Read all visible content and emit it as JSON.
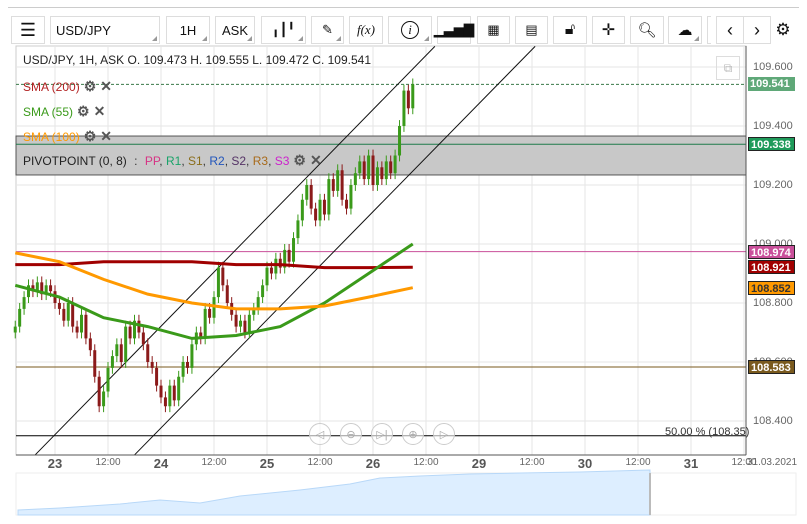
{
  "toolbar": {
    "menu_icon": "hamburger-icon",
    "symbol": "USD/JPY",
    "timeframe": "1H",
    "price_type": "ASK",
    "buttons": [
      "candlestick-icon",
      "pencil-icon",
      "function-icon",
      "info-icon",
      "bar-chart-icon",
      "calendar-icon",
      "report-icon",
      "lock-icon",
      "crosshair-icon",
      "zoom-icon",
      "cloud-upload-icon",
      "chevron-left-icon",
      "chevron-right-icon",
      "gear-icon"
    ],
    "fx_label": "f(x)"
  },
  "legend": {
    "header": "USD/JPY, 1H, ASK   O. 109.473 H. 109.555 L. 109.472 C. 109.541",
    "indicators": [
      {
        "label": "SMA (200)",
        "color": "#b22222"
      },
      {
        "label": "SMA (55)",
        "color": "#3a9a1a"
      },
      {
        "label": "SMA (100)",
        "color": "#ff9900"
      }
    ],
    "pivot": {
      "label": "PIVOTPOINT (0, 8)",
      "sep": " : ",
      "levels": [
        {
          "t": "PP",
          "c": "#d63384"
        },
        {
          "t": "R1",
          "c": "#1aa36a"
        },
        {
          "t": "S1",
          "c": "#8a6d1a"
        },
        {
          "t": "R2",
          "c": "#2255bb"
        },
        {
          "t": "S2",
          "c": "#553366"
        },
        {
          "t": "R3",
          "c": "#a86a1a"
        },
        {
          "t": "S3",
          "c": "#cc22cc"
        }
      ]
    }
  },
  "price_axis": {
    "ticks": [
      "109.600",
      "109.400",
      "109.200",
      "109.000",
      "108.800",
      "108.600",
      "108.400"
    ],
    "tags": [
      {
        "value": "109.541",
        "bg": "#5fa878"
      },
      {
        "value": "109.338",
        "bg": "#1e9a5a"
      },
      {
        "value": "108.974",
        "bg": "#c94f9a"
      },
      {
        "value": "108.921",
        "bg": "#a00000"
      },
      {
        "value": "108.852",
        "bg": "#ff9900"
      },
      {
        "value": "108.583",
        "bg": "#7a5a1e"
      }
    ]
  },
  "time_axis": {
    "labels": [
      {
        "t": "23",
        "day": true
      },
      {
        "t": "12:00"
      },
      {
        "t": "24",
        "day": true
      },
      {
        "t": "12:00"
      },
      {
        "t": "25",
        "day": true
      },
      {
        "t": "12:00"
      },
      {
        "t": "26",
        "day": true
      },
      {
        "t": "12:00"
      },
      {
        "t": "29",
        "day": true
      },
      {
        "t": "12:00"
      },
      {
        "t": "30",
        "day": true
      },
      {
        "t": "12:00"
      },
      {
        "t": "31",
        "day": true
      },
      {
        "t": "12:00"
      }
    ],
    "end_date": "31.03.2021"
  },
  "fib_label": "50.00 % (108.35)",
  "nav_buttons": [
    "scroll-left-icon",
    "zoom-out-icon",
    "scroll-end-icon",
    "zoom-in-icon",
    "scroll-right-icon"
  ],
  "chart_data": {
    "type": "candlestick",
    "symbol": "USD/JPY",
    "interval": "1H",
    "ylim": [
      108.3,
      109.65
    ],
    "x_start": "22 15:00",
    "closes": [
      108.72,
      108.78,
      108.82,
      108.86,
      108.84,
      108.87,
      108.83,
      108.86,
      108.84,
      108.8,
      108.78,
      108.74,
      108.8,
      108.72,
      108.7,
      108.76,
      108.68,
      108.64,
      108.55,
      108.45,
      108.5,
      108.58,
      108.62,
      108.66,
      108.6,
      108.72,
      108.68,
      108.74,
      108.7,
      108.66,
      108.6,
      108.58,
      108.52,
      108.48,
      108.45,
      108.52,
      108.47,
      108.55,
      108.6,
      108.58,
      108.66,
      108.7,
      108.68,
      108.78,
      108.75,
      108.82,
      108.92,
      108.86,
      108.8,
      108.76,
      108.72,
      108.74,
      108.7,
      108.76,
      108.78,
      108.82,
      108.86,
      108.92,
      108.9,
      108.95,
      108.92,
      108.98,
      108.94,
      109.02,
      109.08,
      109.15,
      109.2,
      109.12,
      109.08,
      109.15,
      109.1,
      109.22,
      109.18,
      109.25,
      109.15,
      109.12,
      109.2,
      109.24,
      109.28,
      109.22,
      109.3,
      109.2,
      109.26,
      109.22,
      109.28,
      109.24,
      109.3,
      109.4,
      109.52,
      109.46,
      109.541
    ],
    "colors": {
      "up": "#3a9a1a",
      "down": "#8b1a1a"
    },
    "sma": [
      {
        "name": "SMA (200)",
        "color": "#a00000",
        "values": [
          108.93,
          108.93,
          108.94,
          108.94,
          108.94,
          108.93,
          108.93,
          108.92,
          108.92,
          108.921
        ]
      },
      {
        "name": "SMA (55)",
        "color": "#3a9a1a",
        "values": [
          108.86,
          108.82,
          108.75,
          108.72,
          108.68,
          108.69,
          108.72,
          108.8,
          108.9,
          109.0
        ]
      },
      {
        "name": "SMA (100)",
        "color": "#ff9900",
        "values": [
          108.97,
          108.94,
          108.88,
          108.83,
          108.8,
          108.78,
          108.78,
          108.79,
          108.82,
          108.852
        ]
      }
    ],
    "hlines": [
      {
        "value": 109.541,
        "color": "#3a7a4a",
        "dash": true
      },
      {
        "value": 109.338,
        "color": "#1e7a4a"
      },
      {
        "value": 108.974,
        "color": "#c94f9a"
      },
      {
        "value": 108.583,
        "color": "#7a5a1e"
      },
      {
        "value": 108.35,
        "color": "#000000"
      }
    ],
    "band": [
      109.234,
      109.366
    ],
    "channel": [
      {
        "from": [
          -4.5,
          108.285
        ],
        "to": [
          86,
          109.67
        ]
      },
      {
        "from": [
          18,
          108.285
        ],
        "to": [
          108.7,
          109.67
        ]
      }
    ]
  }
}
